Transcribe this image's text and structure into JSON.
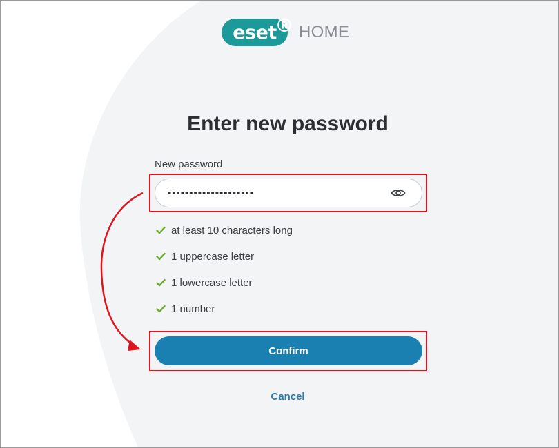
{
  "logo": {
    "brand": "eset",
    "registered": "®",
    "product": "HOME"
  },
  "page": {
    "title": "Enter new password"
  },
  "form": {
    "password_label": "New password",
    "password_value": "••••••••••••••••••••",
    "requirements": [
      {
        "text": "at least 10 characters long",
        "met": true
      },
      {
        "text": "1 uppercase letter",
        "met": true
      },
      {
        "text": "1 lowercase letter",
        "met": true
      },
      {
        "text": "1 number",
        "met": true
      }
    ],
    "confirm_label": "Confirm",
    "cancel_label": "Cancel"
  },
  "colors": {
    "brand": "#1c9a9a",
    "primary_button": "#1a7fb1",
    "link": "#2a7aa8",
    "check": "#6aab2e",
    "annotation": "#e0141e",
    "background_shape": "#f3f4f6"
  },
  "icons": {
    "eye": "eye-icon",
    "check": "check-icon"
  }
}
